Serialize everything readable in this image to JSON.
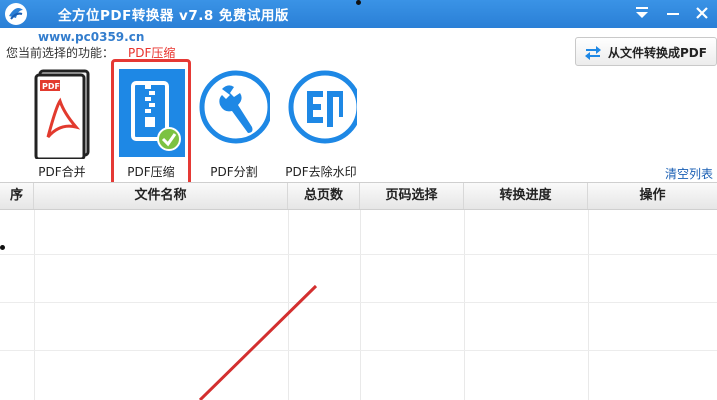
{
  "titlebar": {
    "title": "全方位PDF转换器 v7.8 免费试用版",
    "watermark": "www.pc0359.cn",
    "color": "#2a7fd6"
  },
  "toolbar": {
    "current_label": "您当前选择的功能：",
    "current_value": "PDF压缩",
    "convert_button": "从文件转换成PDF",
    "tools": [
      {
        "label": "PDF合并",
        "icon": "pdf-merge-icon"
      },
      {
        "label": "PDF压缩",
        "icon": "pdf-compress-icon",
        "selected": true
      },
      {
        "label": "PDF分割",
        "icon": "wrench-icon"
      },
      {
        "label": "PDF去除水印",
        "icon": "watermark-remove-icon"
      }
    ],
    "clear_list": "清空列表"
  },
  "table": {
    "columns": [
      "序",
      "文件名称",
      "总页数",
      "页码选择",
      "转换进度",
      "操作"
    ]
  },
  "colors": {
    "accent_blue": "#1e88e5",
    "selection_red": "#e53935",
    "annotation_red": "#d32f2f"
  }
}
